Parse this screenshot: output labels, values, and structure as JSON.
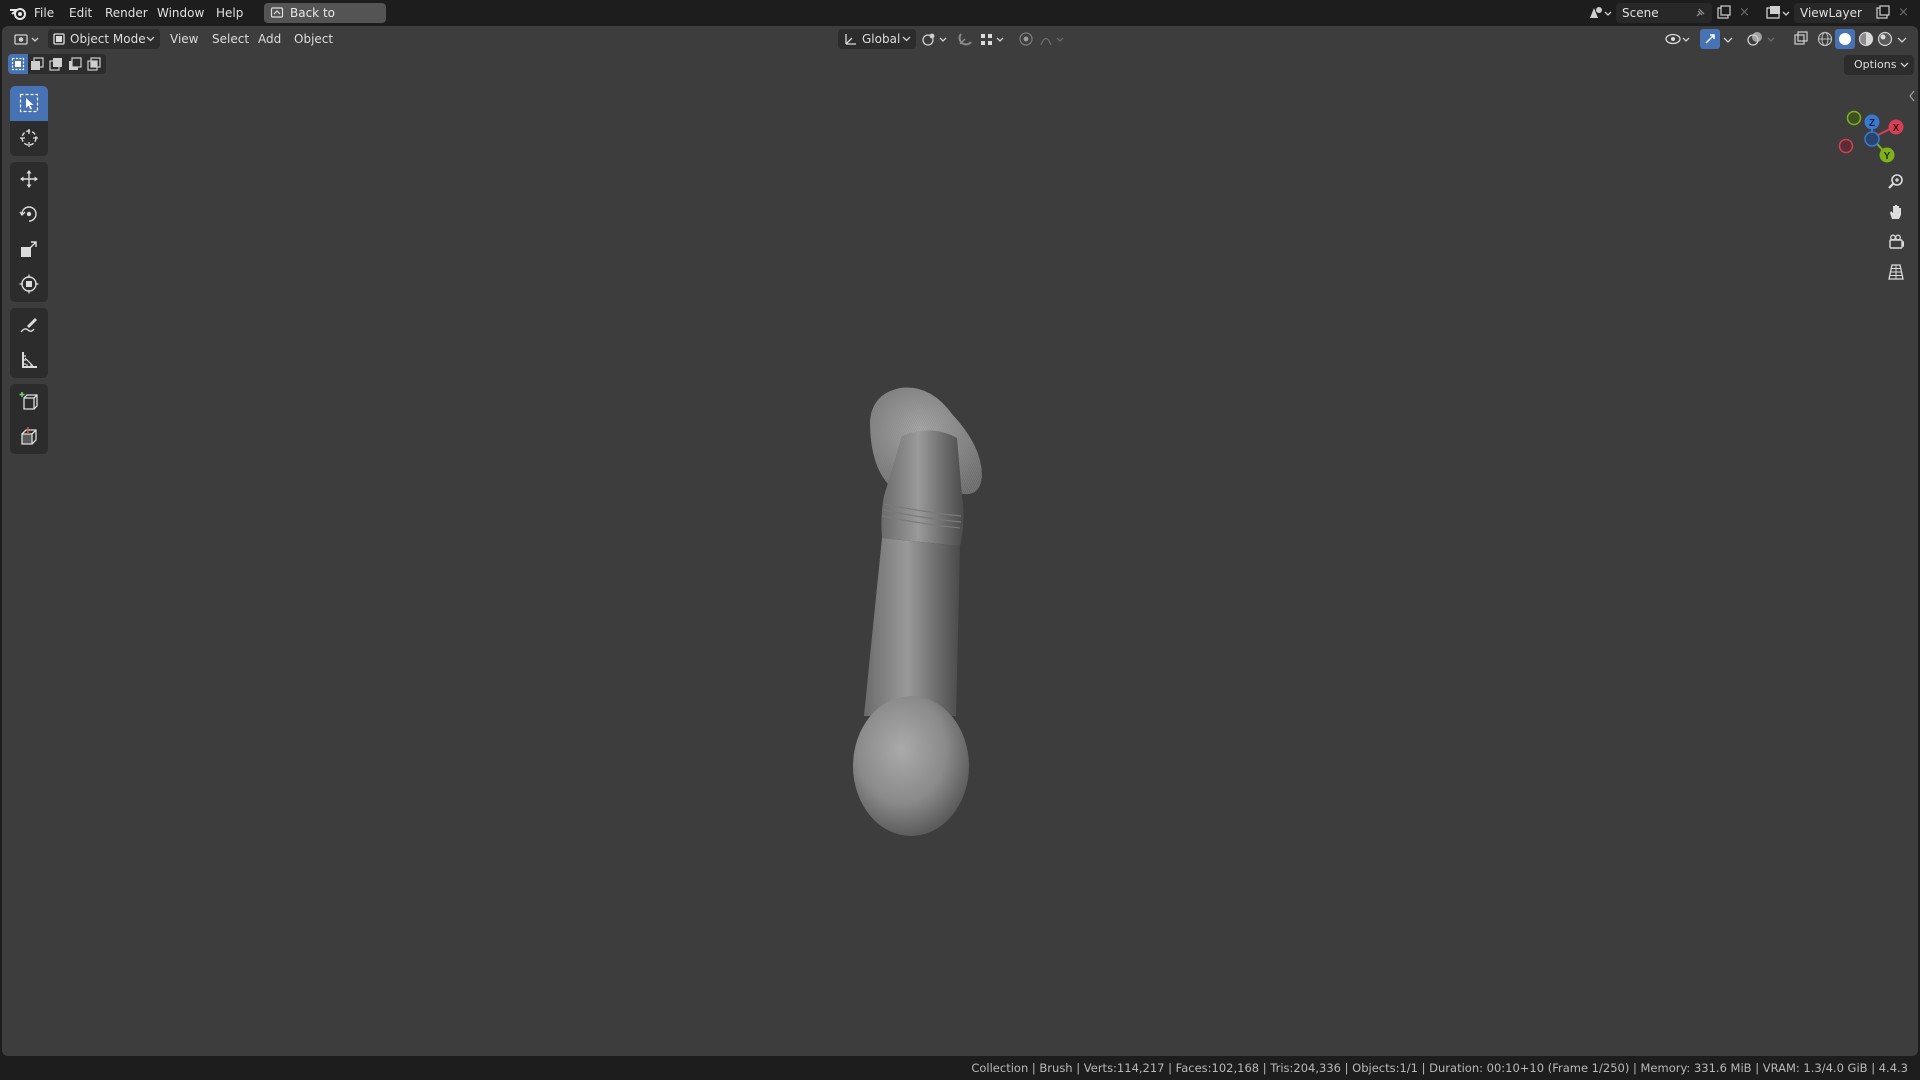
{
  "topbar": {
    "menu": [
      "File",
      "Edit",
      "Render",
      "Window",
      "Help"
    ],
    "back_button": "Back to Previous",
    "scene_field": "Scene",
    "viewlayer_field": "ViewLayer"
  },
  "viewport_header": {
    "mode": "Object Mode",
    "menu": [
      "View",
      "Select",
      "Add",
      "Object"
    ],
    "orientation": "Global",
    "options": "Options"
  },
  "gizmo": {
    "x_label": "X",
    "y_label": "Y",
    "z_label": "Z",
    "colors": {
      "x": "#d83f53",
      "y": "#7fb11d",
      "z": "#3a79d1"
    }
  },
  "toolbar_icons": [
    "select-box-icon",
    "cursor-icon",
    "move-icon",
    "rotate-icon",
    "scale-icon",
    "transform-icon",
    "annotate-icon",
    "measure-icon",
    "add-cube-icon",
    "extrude-icon"
  ],
  "status": {
    "text": "Collection | Brush | Verts:114,217 | Faces:102,168 | Tris:204,336 | Objects:1/1 | Duration: 00:10+10 (Frame 1/250) | Memory: 331.6 MiB | VRAM: 1.3/4.0 GiB | 4.4.3"
  },
  "colors": {
    "accent": "#4772b3",
    "viewport_bg": "#3d3d3d",
    "header_bg": "#1d1d1d"
  }
}
